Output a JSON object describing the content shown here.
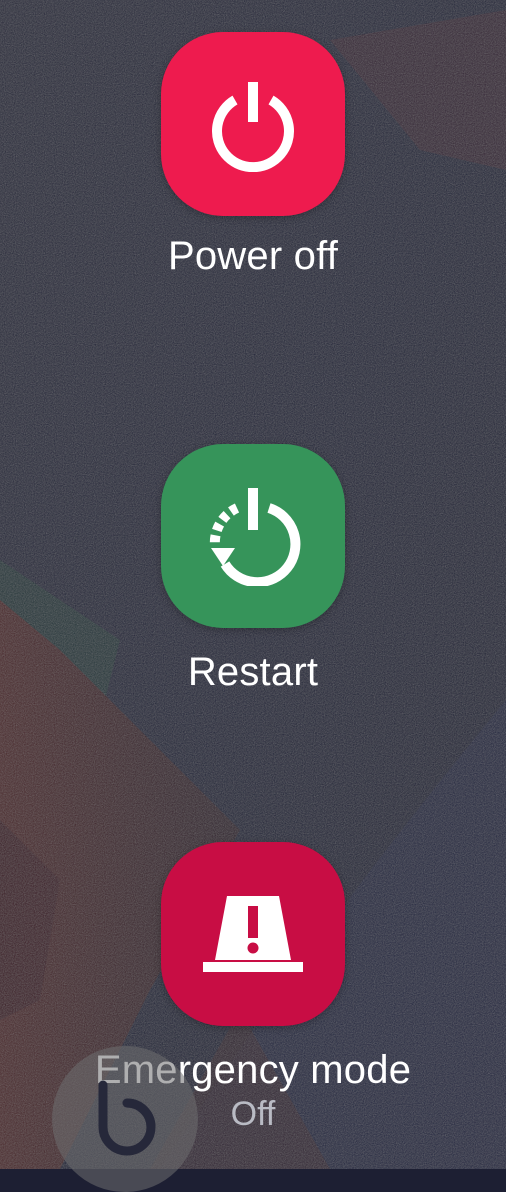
{
  "colors": {
    "power_off": "#ee1b4e",
    "restart": "#36945a",
    "emergency": "#c80d44",
    "label": "#ffffff",
    "sublabel": "#b9bbc4"
  },
  "power_off": {
    "label": "Power off",
    "icon": "power-icon"
  },
  "restart": {
    "label": "Restart",
    "icon": "restart-icon"
  },
  "emergency_mode": {
    "label": "Emergency mode",
    "status": "Off",
    "icon": "emergency-beacon-icon"
  },
  "floating_bubble": {
    "icon": "bixby-icon"
  }
}
